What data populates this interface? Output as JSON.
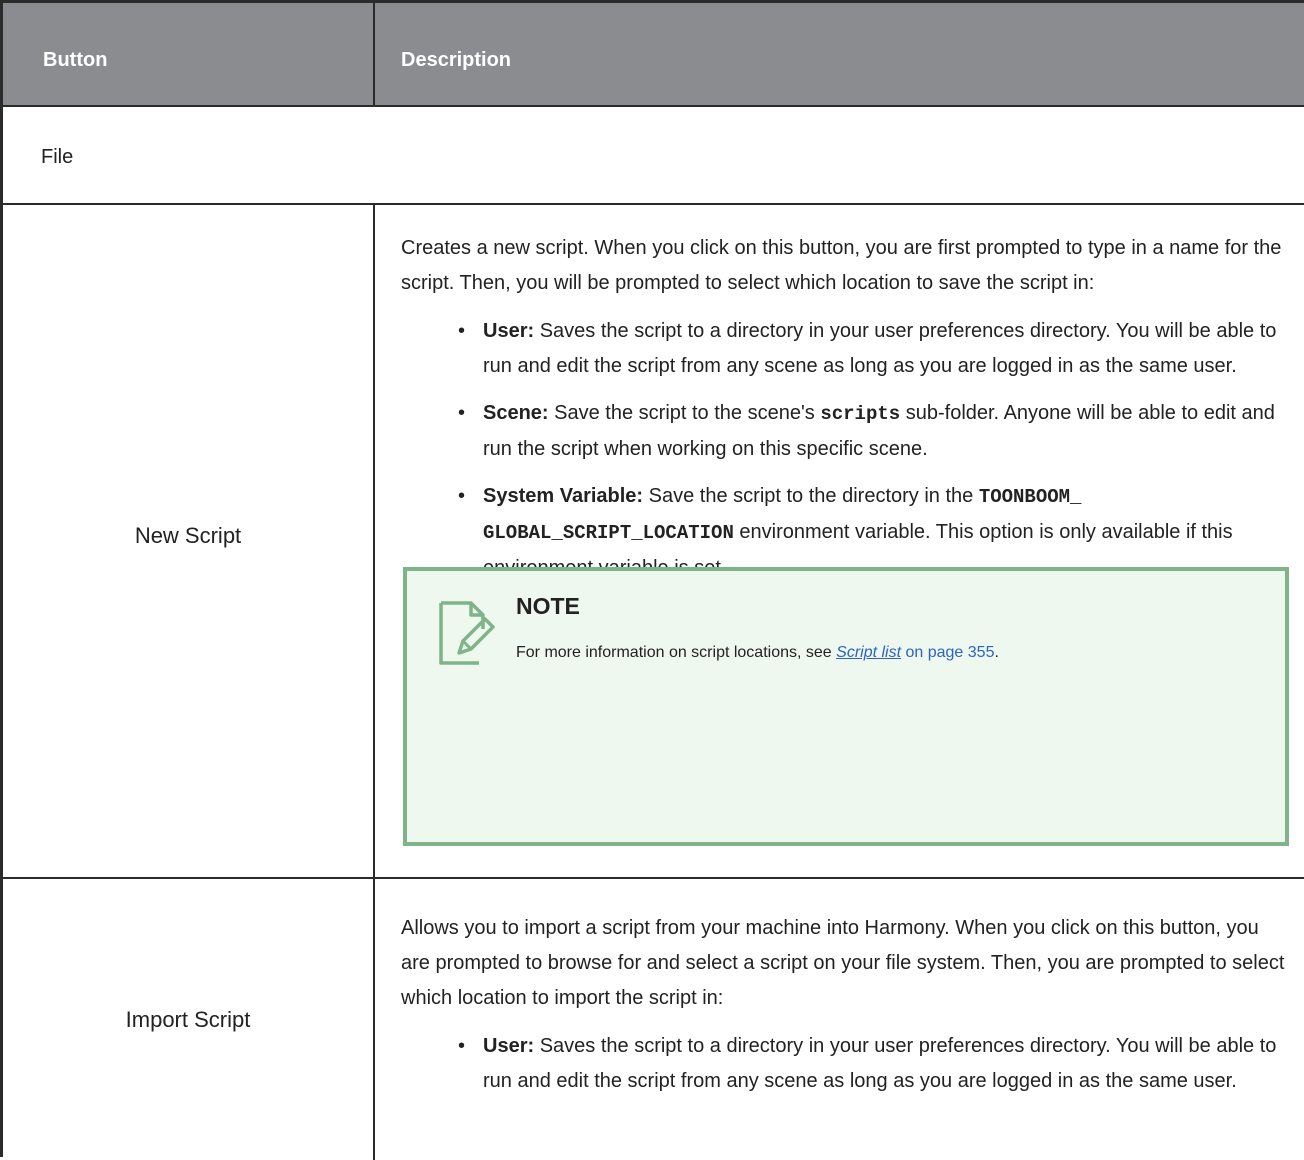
{
  "header": {
    "col_button": "Button",
    "col_description": "Description"
  },
  "section": {
    "label": "File"
  },
  "rows": {
    "new_script": {
      "name": "New Script",
      "intro": "Creates a new script. When you click on this button, you are first prompted to type in a name for the script. Then, you will be prompted to select which location to save the script in:",
      "user_label": "User:",
      "user_text": " Saves the script to a directory in your user preferences directory. You will be able to run and edit the script from any scene as long as you are logged in as the same user.",
      "scene_label": "Scene:",
      "scene_text_before": " Save the script to the scene's ",
      "scene_code": "scripts",
      "scene_text_after": " sub-folder. Anyone will be able to edit and run the script when working on this specific scene.",
      "system_label": "System Variable:",
      "system_text_before": " Save the script to the directory in the ",
      "system_code": "TOONBOOM_ GLOBAL_SCRIPT_LOCATION",
      "system_text_after": " environment variable. This option is only available if this environment variable is set.",
      "note": {
        "title": "NOTE",
        "text_before": "For more information on script locations, see ",
        "link": "Script list",
        "page": " on page 355",
        "text_after": "."
      }
    },
    "import_script": {
      "name": "Import Script",
      "intro": "Allows you to import a script from your machine into Harmony. When you click on this button, you are prompted to browse for and select a script on your file system. Then, you are prompted to select which location to import the script in:",
      "user_label": "User:",
      "user_text": " Saves the script to a directory in your user preferences directory. You will be able to run and edit the script from any scene as long as you are logged in as the same user."
    }
  },
  "colors": {
    "header_bg": "#8a8c8f",
    "note_border": "#7fb48a",
    "note_bg": "#eef8ee",
    "link": "#2c63c7"
  },
  "icons": {
    "note": "note-pencil-icon",
    "bullet": "bullet-dot"
  }
}
